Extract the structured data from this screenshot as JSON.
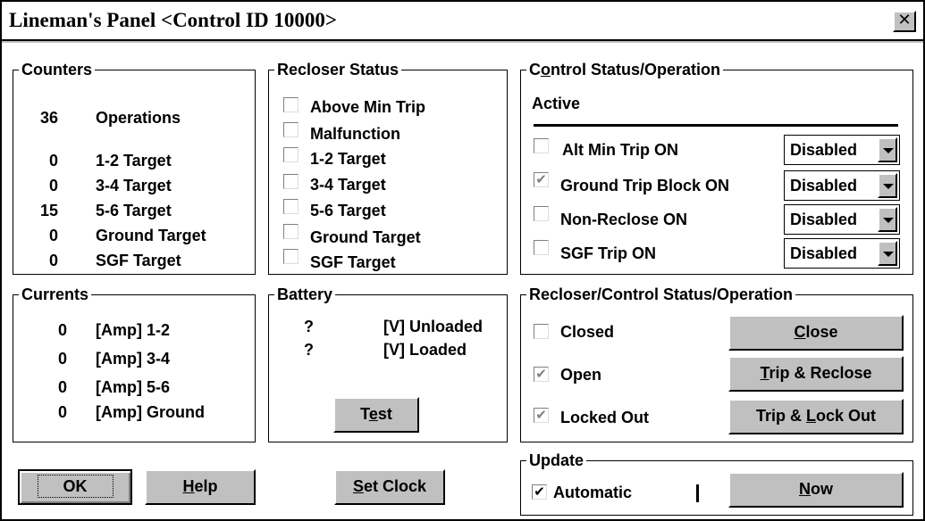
{
  "window": {
    "title": "Lineman's Panel <Control ID 10000>",
    "close_glyph": "✕"
  },
  "counters": {
    "legend": "Counters",
    "rows": [
      {
        "value": "36",
        "label": "Operations"
      },
      {
        "value": "0",
        "label": "1-2 Target"
      },
      {
        "value": "0",
        "label": "3-4 Target"
      },
      {
        "value": "15",
        "label": "5-6 Target"
      },
      {
        "value": "0",
        "label": "Ground Target"
      },
      {
        "value": "0",
        "label": "SGF Target"
      }
    ]
  },
  "recloser_status": {
    "legend": "Recloser Status",
    "items": [
      {
        "label": "Above Min Trip",
        "checked": false
      },
      {
        "label": "Malfunction",
        "checked": false
      },
      {
        "label": "1-2 Target",
        "checked": false
      },
      {
        "label": "3-4 Target",
        "checked": false
      },
      {
        "label": "5-6 Target",
        "checked": false
      },
      {
        "label": "Ground Target",
        "checked": false
      },
      {
        "label": "SGF Target",
        "checked": false
      }
    ]
  },
  "control_status": {
    "legend_pre": "C",
    "legend_ul": "o",
    "legend_post": "ntrol Status/Operation",
    "active_label": "Active",
    "rows": [
      {
        "label": "Alt Min Trip ON",
        "checked": false,
        "disabled": false,
        "select": "Disabled"
      },
      {
        "label": "Ground Trip Block ON",
        "checked": true,
        "disabled": true,
        "select": "Disabled"
      },
      {
        "label": "Non-Reclose ON",
        "checked": false,
        "disabled": false,
        "select": "Disabled"
      },
      {
        "label": "SGF Trip ON",
        "checked": false,
        "disabled": false,
        "select": "Disabled"
      }
    ]
  },
  "currents": {
    "legend": "Currents",
    "rows": [
      {
        "value": "0",
        "label": "[Amp] 1-2"
      },
      {
        "value": "0",
        "label": "[Amp] 3-4"
      },
      {
        "value": "0",
        "label": "[Amp] 5-6"
      },
      {
        "value": "0",
        "label": "[Amp] Ground"
      }
    ]
  },
  "battery": {
    "legend": "Battery",
    "rows": [
      {
        "value": "?",
        "label": "[V] Unloaded"
      },
      {
        "value": "?",
        "label": "[V] Loaded"
      }
    ],
    "test_pre": "T",
    "test_ul": "e",
    "test_post": "st"
  },
  "recloser_control": {
    "legend": "Recloser/Control Status/Operation",
    "rows": [
      {
        "label": "Closed",
        "checked": false,
        "disabled": false
      },
      {
        "label": "Open",
        "checked": true,
        "disabled": true
      },
      {
        "label": "Locked Out",
        "checked": true,
        "disabled": true
      }
    ],
    "close_ul": "C",
    "close_post": "lose",
    "trip_reclose_ul": "T",
    "trip_reclose_post": "rip & Reclose",
    "trip_lock_pre": "Trip & ",
    "trip_lock_ul": "L",
    "trip_lock_post": "ock Out"
  },
  "update": {
    "legend": "Update",
    "automatic_label": "Automatic",
    "automatic_checked": true,
    "now_ul": "N",
    "now_post": "ow"
  },
  "footer": {
    "ok_label": "OK",
    "help_ul": "H",
    "help_post": "elp",
    "setclock_ul": "S",
    "setclock_post": "et Clock"
  },
  "glyphs": {
    "check": "✔"
  }
}
